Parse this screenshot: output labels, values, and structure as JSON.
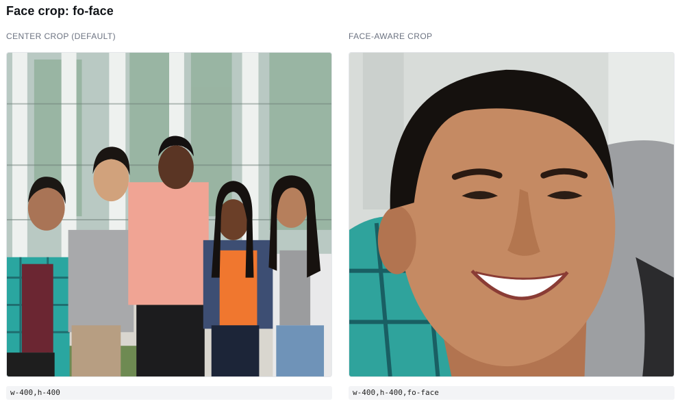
{
  "page": {
    "title": "Face crop: fo-face"
  },
  "panels": [
    {
      "label": "CENTER CROP (DEFAULT)",
      "transform": "w-400,h-400",
      "image": "group-photo-five-friends"
    },
    {
      "label": "FACE-AWARE CROP",
      "transform": "w-400,h-400,fo-face",
      "image": "cropped-smiling-face"
    }
  ]
}
